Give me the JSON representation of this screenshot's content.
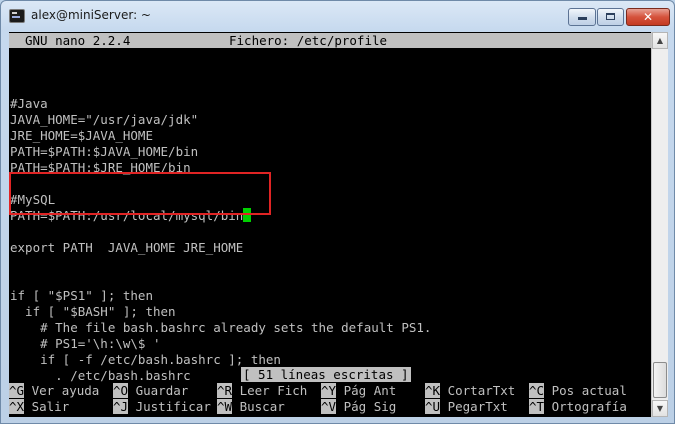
{
  "window": {
    "title": "alex@miniServer: ~",
    "app_icon": "terminal-icon",
    "controls": {
      "minimize": "minimize-icon",
      "maximize": "maximize-icon",
      "close_glyph": "✕"
    }
  },
  "nano": {
    "version": "GNU nano 2.2.4",
    "file_label": "Fichero: /etc/profile",
    "lines": [
      "",
      "#Java",
      "JAVA_HOME=\"/usr/java/jdk\"",
      "JRE_HOME=$JAVA_HOME",
      "PATH=$PATH:$JAVA_HOME/bin",
      "PATH=$PATH:$JRE_HOME/bin",
      "",
      "#MySQL",
      "PATH=$PATH:/usr/local/mysql/bin",
      "",
      "export PATH  JAVA_HOME JRE_HOME",
      "",
      "",
      "if [ \"$PS1\" ]; then",
      "  if [ \"$BASH\" ]; then",
      "    # The file bash.bashrc already sets the default PS1.",
      "    # PS1='\\h:\\w\\$ '",
      "    if [ -f /etc/bash.bashrc ]; then",
      "      . /etc/bash.bashrc"
    ],
    "status": "[ 51 líneas escritas ]",
    "shortcuts_row1": [
      {
        "key": "^G",
        "label": "Ver ayuda"
      },
      {
        "key": "^O",
        "label": "Guardar"
      },
      {
        "key": "^R",
        "label": "Leer Fich"
      },
      {
        "key": "^Y",
        "label": "Pág Ant"
      },
      {
        "key": "^K",
        "label": "CortarTxt"
      },
      {
        "key": "^C",
        "label": "Pos actual"
      }
    ],
    "shortcuts_row2": [
      {
        "key": "^X",
        "label": "Salir"
      },
      {
        "key": "^J",
        "label": "Justificar"
      },
      {
        "key": "^W",
        "label": "Buscar"
      },
      {
        "key": "^V",
        "label": "Pág Sig"
      },
      {
        "key": "^U",
        "label": "PegarTxt"
      },
      {
        "key": "^T",
        "label": "Ortografía"
      }
    ]
  },
  "colors": {
    "terminal_bg": "#000000",
    "text": "#c0c0c0",
    "cursor": "#00d000",
    "highlight_border": "#e02424"
  }
}
